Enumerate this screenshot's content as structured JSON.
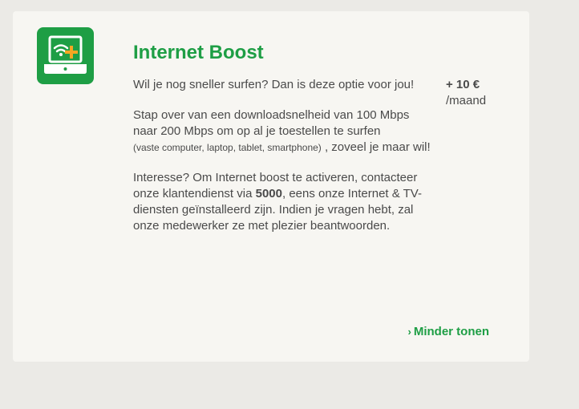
{
  "option": {
    "title": "Internet Boost",
    "icon": "internet-boost-laptop-icon",
    "intro": "Wil je nog sneller surfen? Dan is deze optie voor jou!",
    "price": {
      "amount": "+ 10 €",
      "unit": "/maand"
    },
    "speed_text": "Stap over van een downloadsnelheid van 100 Mbps naar 200 Mbps om op al je toestellen te surfen",
    "devices_text": "(vaste computer, laptop, tablet, smartphone)",
    "speed_text_end": ", zoveel je maar wil!",
    "interest_text_1": "Interesse? Om Internet boost te activeren, contacteer onze klantendienst via",
    "phone_number": "5000",
    "interest_text_2": ", eens onze Internet & TV-diensten geïnstalleerd zijn. Indien je vragen hebt, zal onze medewerker ze met plezier beantwoorden."
  },
  "actions": {
    "toggle_chevron": "›",
    "toggle_label": "Minder tonen"
  },
  "colors": {
    "brand_green": "#1e9e45",
    "accent_orange": "#f5a623",
    "card_background": "#f7f6f2",
    "page_background": "#ebeae6"
  }
}
